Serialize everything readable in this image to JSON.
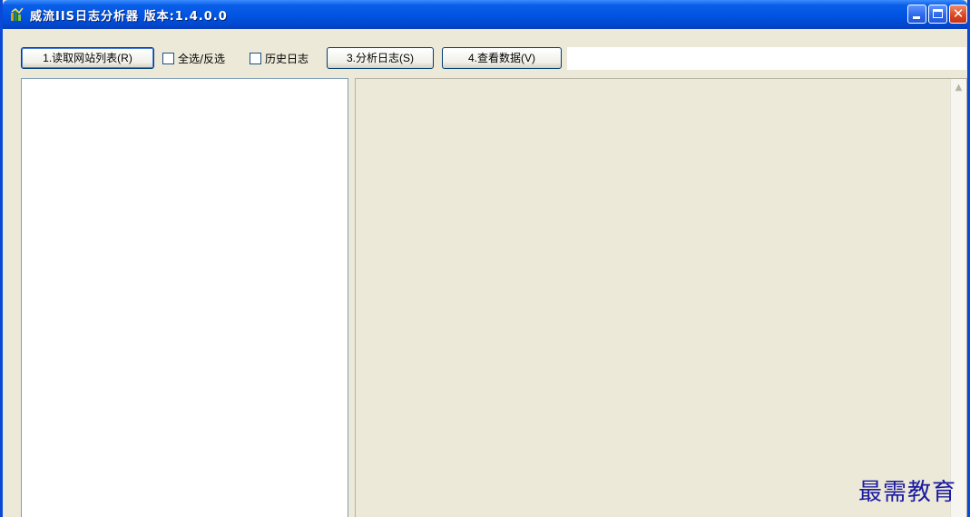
{
  "window": {
    "title": "威流IIS日志分析器 版本:1.4.0.0"
  },
  "toolbar": {
    "read_sites_label": "1.读取网站列表(R)",
    "select_all_label": "全选/反选",
    "history_log_label": "历史日志",
    "analyze_label": "3.分析日志(S)",
    "view_data_label": "4.查看数据(V)",
    "path_value": ""
  },
  "watermark": "最需教育",
  "colors": {
    "titlebar": "#0053e1",
    "window_bg": "#ece9d8",
    "watermark": "#1a1aa0"
  }
}
